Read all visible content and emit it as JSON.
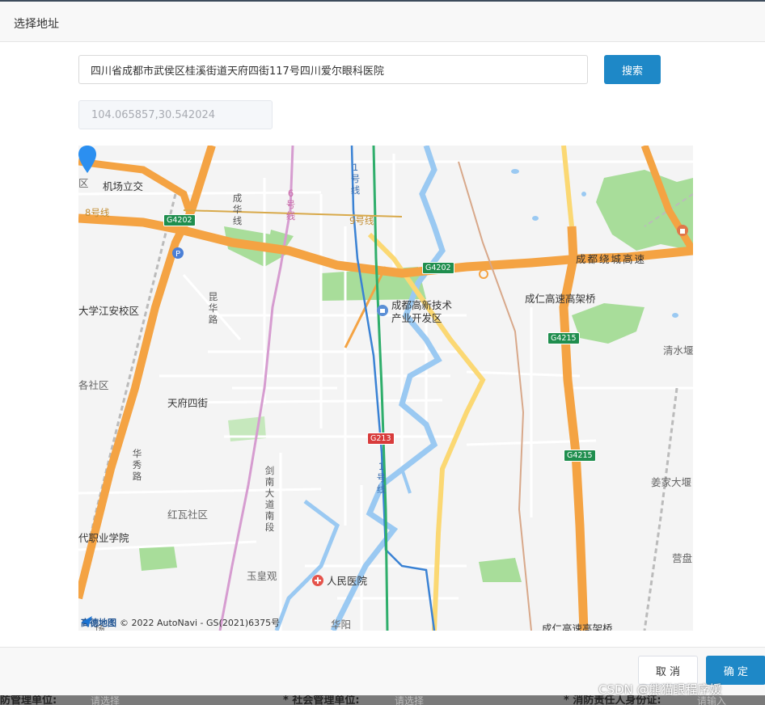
{
  "dialog": {
    "title": "选择地址",
    "address_value": "四川省成都市武侯区桂溪街道天府四街117号四川爱尔眼科医院",
    "search_label": "搜索",
    "coordinates_value": "104.065857,30.542024",
    "cancel_label": "取 消",
    "confirm_label": "确 定"
  },
  "map": {
    "labels": {
      "airport": "机场立交",
      "campus": "大学江安校区",
      "community_left": "各社区",
      "tianfu4": "天府四街",
      "hongwa": "红瓦社区",
      "college": "代职业学院",
      "yuhuang": "玉皇观",
      "hospital": "人民医院",
      "huayang": "华阳",
      "hitech": "成都高新技术",
      "hitech2": "产业开发区",
      "chengren": "成仁高速高架桥",
      "chengren_bottom": "成仁高速高架桥",
      "ringexp": "成都绕城高速",
      "qingshui": "清水堰",
      "jiangjia": "姜家大堰",
      "yingpan": "营盘",
      "line8": "8号线",
      "line9": "9号线",
      "line1_top": "1号线",
      "line1_mid": "1号线",
      "line6": "6号线",
      "chenghua": "成华线",
      "kunhua": "昆华路",
      "huaxiu": "华秀路",
      "jiannan": "剑南大道南段",
      "edge_left": "区",
      "edge_bottom_left": "场"
    },
    "shields": {
      "g4202_a": "G4202",
      "g4202_b": "G4202",
      "g4215_a": "G4215",
      "g4215_b": "G4215",
      "g213": "G213"
    },
    "attribution": "© 2022 AutoNavi - GS(2021)6375号",
    "logo_text": "高德地图"
  },
  "background_form": {
    "label_1": "防管理单位:",
    "placeholder_1": "请选择",
    "label_2": "* 社会管理单位:",
    "placeholder_2": "请选择",
    "label_3": "* 消防责任人身份证:",
    "placeholder_3": "请输入"
  },
  "watermark": "CSDN @熊猫眼程序媛",
  "colors": {
    "primary": "#1e88c7",
    "highway": "#f4a343",
    "park": "#a8dd9a",
    "water": "#9ac9f2",
    "pin": "#2b8ff0"
  }
}
